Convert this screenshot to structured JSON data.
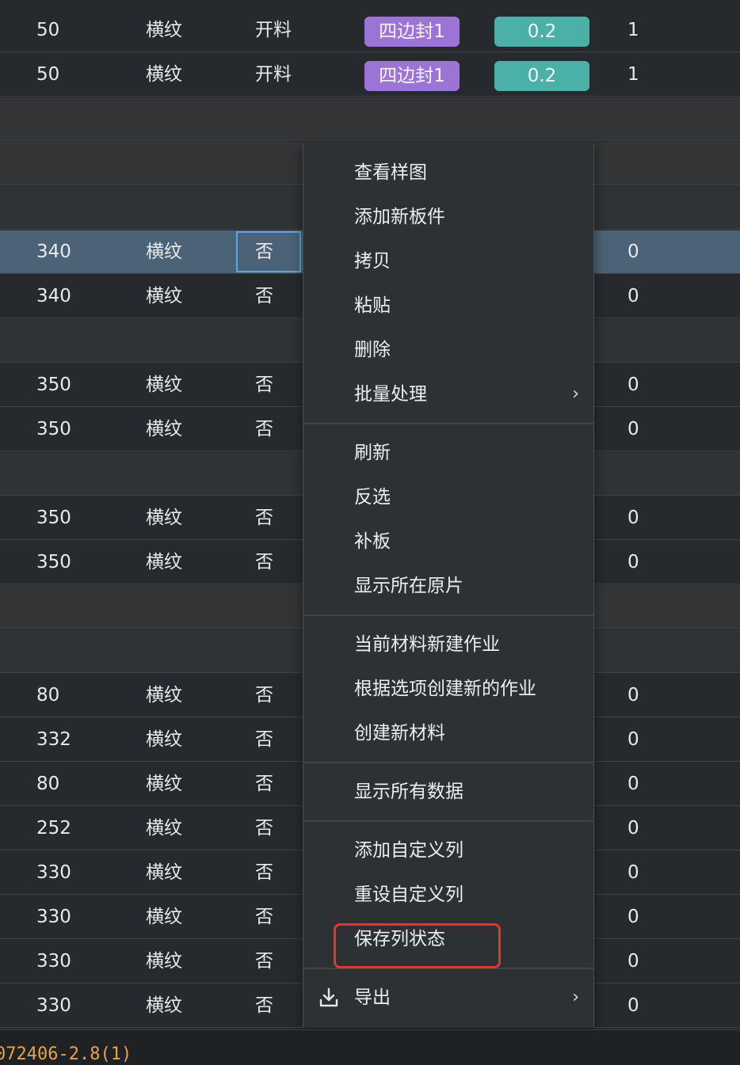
{
  "table": {
    "rows": [
      {
        "type": "data",
        "cells": [
          "50",
          "横纹",
          "开料",
          "",
          "",
          "",
          "1"
        ],
        "edge": "四边封1",
        "val": "0.2"
      },
      {
        "type": "data",
        "cells": [
          "50",
          "横纹",
          "开料",
          "",
          "",
          "",
          "1"
        ],
        "edge": "四边封1",
        "val": "0.2"
      },
      {
        "type": "group-dark",
        "cells": []
      },
      {
        "type": "group-dark",
        "cells": []
      },
      {
        "type": "group",
        "cells": []
      },
      {
        "type": "selected",
        "cells": [
          "340",
          "横纹",
          "否",
          "",
          "",
          "",
          "0"
        ]
      },
      {
        "type": "data",
        "cells": [
          "340",
          "横纹",
          "否",
          "",
          "",
          "",
          "0"
        ]
      },
      {
        "type": "group",
        "cells": []
      },
      {
        "type": "data",
        "cells": [
          "350",
          "横纹",
          "否",
          "",
          "",
          "",
          "0"
        ]
      },
      {
        "type": "data",
        "cells": [
          "350",
          "横纹",
          "否",
          "",
          "",
          "",
          "0"
        ]
      },
      {
        "type": "group",
        "cells": []
      },
      {
        "type": "data",
        "cells": [
          "350",
          "横纹",
          "否",
          "",
          "",
          "",
          "0"
        ]
      },
      {
        "type": "data",
        "cells": [
          "350",
          "横纹",
          "否",
          "",
          "",
          "",
          "0"
        ]
      },
      {
        "type": "group-dark",
        "cells": []
      },
      {
        "type": "group",
        "cells": []
      },
      {
        "type": "data",
        "cells": [
          "80",
          "横纹",
          "否",
          "",
          "",
          "",
          "0"
        ]
      },
      {
        "type": "data",
        "cells": [
          "332",
          "横纹",
          "否",
          "",
          "",
          "",
          "0"
        ]
      },
      {
        "type": "data",
        "cells": [
          "80",
          "横纹",
          "否",
          "",
          "",
          "",
          "0"
        ]
      },
      {
        "type": "data",
        "cells": [
          "252",
          "横纹",
          "否",
          "",
          "",
          "",
          "0"
        ]
      },
      {
        "type": "data",
        "cells": [
          "330",
          "横纹",
          "否",
          "",
          "",
          "",
          "0"
        ]
      },
      {
        "type": "data",
        "cells": [
          "330",
          "横纹",
          "否",
          "",
          "",
          "",
          "0"
        ]
      },
      {
        "type": "data",
        "cells": [
          "330",
          "横纹",
          "否",
          "",
          "",
          "",
          "0"
        ]
      },
      {
        "type": "data",
        "cells": [
          "330",
          "横纹",
          "否",
          "",
          "",
          "",
          "0"
        ]
      }
    ]
  },
  "menu": {
    "items": [
      {
        "label": "查看样图"
      },
      {
        "label": "添加新板件"
      },
      {
        "label": "拷贝"
      },
      {
        "label": "粘贴"
      },
      {
        "label": "删除"
      },
      {
        "label": "批量处理",
        "submenu": true
      },
      {
        "separator": true
      },
      {
        "label": "刷新"
      },
      {
        "label": "反选"
      },
      {
        "label": "补板"
      },
      {
        "label": "显示所在原片"
      },
      {
        "separator": true
      },
      {
        "label": "当前材料新建作业"
      },
      {
        "label": "根据选项创建新的作业"
      },
      {
        "label": "创建新材料"
      },
      {
        "separator": true
      },
      {
        "label": "显示所有数据"
      },
      {
        "separator": true
      },
      {
        "label": "添加自定义列"
      },
      {
        "label": "重设自定义列"
      },
      {
        "label": "保存列状态",
        "highlighted": true
      },
      {
        "separator": true
      },
      {
        "label": "导出",
        "submenu": true,
        "icon": "download-icon"
      }
    ],
    "submenu_arrow": "›"
  },
  "status_bar": {
    "text": "072406-2.8(1)"
  },
  "colors": {
    "edge_badge": "#9b74d6",
    "value_badge": "#4ab0a8",
    "selected_row": "#4c6276",
    "highlight_box": "#e0372e",
    "status_text": "#e8a24a"
  }
}
